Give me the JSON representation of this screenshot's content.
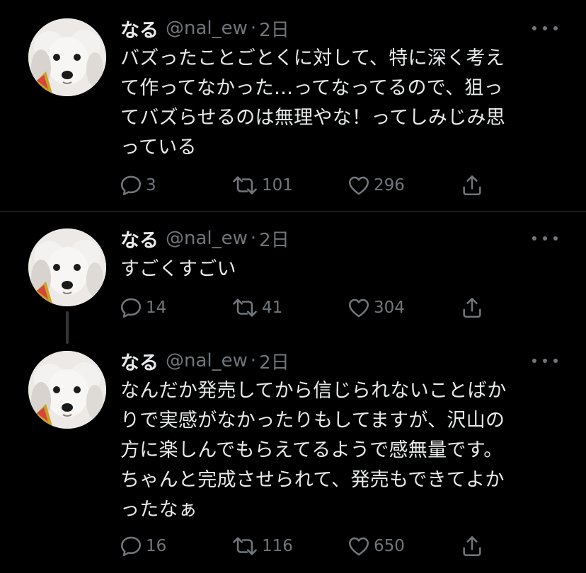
{
  "tweets": [
    {
      "name": "なる",
      "handle": "@nal_ew",
      "dot": "·",
      "time": "2日",
      "lines": [
        "バズったことごとくに対して、特に深く考え",
        "て作ってなかった…ってなってるので、狙っ",
        "てバズらせるのは無理やな！ってしみじみ思",
        "っている"
      ],
      "replies": "3",
      "retweets": "101",
      "likes": "296"
    },
    {
      "name": "なる",
      "handle": "@nal_ew",
      "dot": "·",
      "time": "2日",
      "lines": [
        "すごくすごい"
      ],
      "replies": "14",
      "retweets": "41",
      "likes": "304"
    },
    {
      "name": "なる",
      "handle": "@nal_ew",
      "dot": "·",
      "time": "2日",
      "lines": [
        "なんだか発売してから信じられないことばか",
        "りで実感がなかったりもしてますが、沢山の",
        "方に楽しんでもらえてるようで感無量です。",
        "ちゃんと完成させられて、発売もできてよか",
        "ったなぁ"
      ],
      "replies": "16",
      "retweets": "116",
      "likes": "650"
    }
  ],
  "icons": {
    "reply": "reply-icon",
    "retweet": "retweet-icon",
    "like": "heart-icon",
    "share": "share-icon",
    "more": "more-icon"
  },
  "colors": {
    "background": "#000000",
    "text": "#e7e9ea",
    "secondary": "#71767b",
    "divider": "#2f3336"
  }
}
